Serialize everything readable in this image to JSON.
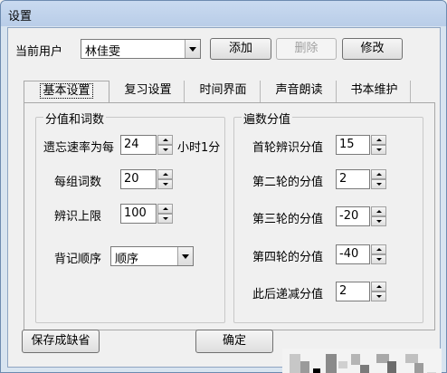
{
  "window": {
    "title": "设置"
  },
  "user": {
    "label": "当前用户",
    "selected": "林佳雯",
    "add_label": "添加",
    "delete_label": "删除",
    "modify_label": "修改"
  },
  "tabs": [
    {
      "label": "基本设置",
      "active": true
    },
    {
      "label": "复习设置",
      "active": false
    },
    {
      "label": "时间界面",
      "active": false
    },
    {
      "label": "声音朗读",
      "active": false
    },
    {
      "label": "书本维护",
      "active": false
    }
  ],
  "score_group": {
    "title": "分值和词数",
    "forget_rate_label": "遗忘速率为每",
    "forget_rate_value": "24",
    "forget_rate_suffix": "小时1分",
    "group_words_label": "每组词数",
    "group_words_value": "20",
    "identify_limit_label": "辨识上限",
    "identify_limit_value": "100",
    "order_label": "背记顺序",
    "order_value": "顺序"
  },
  "pass_group": {
    "title": "遍数分值",
    "first_label": "首轮辨识分值",
    "first_value": "15",
    "second_label": "第二轮的分值",
    "second_value": "2",
    "third_label": "第三轮的分值",
    "third_value": "-20",
    "fourth_label": "第四轮的分值",
    "fourth_value": "-40",
    "after_label": "此后递减分值",
    "after_value": "2"
  },
  "footer": {
    "save_default_label": "保存成缺省",
    "ok_label": "确定"
  }
}
